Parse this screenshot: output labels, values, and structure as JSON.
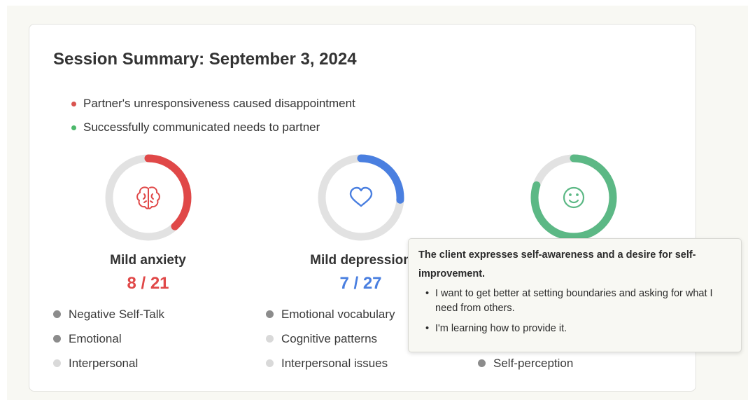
{
  "summary": {
    "title": "Session Summary: September 3, 2024",
    "highlights": [
      {
        "text": "Partner's unresponsiveness caused disappointment",
        "color": "#d9534f"
      },
      {
        "text": "Successfully communicated needs to partner",
        "color": "#4cb86b"
      }
    ]
  },
  "metrics": [
    {
      "label": "Mild anxiety",
      "score": "8 / 21",
      "value": 8,
      "max": 21,
      "color": "#e04848",
      "icon": "brain-icon",
      "tags": [
        {
          "text": "Negative Self-Talk",
          "dot": "#8c8c8c"
        },
        {
          "text": "Emotional",
          "dot": "#8c8c8c"
        },
        {
          "text": "Interpersonal",
          "dot": "#d9d9d9"
        }
      ]
    },
    {
      "label": "Mild depression",
      "score": "7 / 27",
      "value": 7,
      "max": 27,
      "color": "#4a7fe0",
      "icon": "heart-icon",
      "tags": [
        {
          "text": "Emotional vocabulary",
          "dot": "#8c8c8c"
        },
        {
          "text": "Cognitive patterns",
          "dot": "#d9d9d9"
        },
        {
          "text": "Interpersonal issues",
          "dot": "#d9d9d9"
        }
      ]
    },
    {
      "label": "",
      "score": "",
      "value": 0.8,
      "max": 1,
      "color": "#5cb885",
      "icon": "smile-icon",
      "tags": [
        {
          "text": "",
          "dot": ""
        },
        {
          "text": "",
          "dot": ""
        },
        {
          "text": "Self-perception",
          "dot": "#8c8c8c"
        }
      ]
    }
  ],
  "tooltip": {
    "title": "The client expresses self-awareness and a desire for self-improvement.",
    "items": [
      "I want to get better at setting boundaries and asking for what I need from others.",
      "I'm learning how to provide it."
    ]
  }
}
